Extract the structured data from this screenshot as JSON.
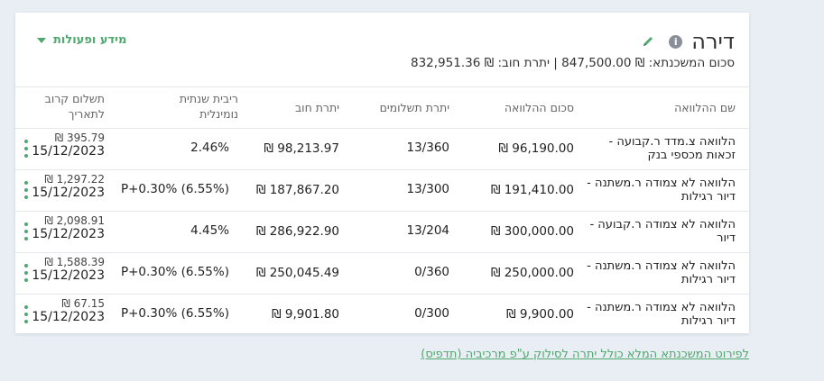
{
  "header": {
    "title": "דירה",
    "info_icon": "i",
    "subtitle": "סכום המשכנתא: ‎847,500.00 ₪‎ | יתרת חוב: ‎832,951.36 ₪‎",
    "actions_label": "מידע ופעולות"
  },
  "table": {
    "columns": {
      "name": "שם ההלוואה",
      "amount": "סכום ההלוואה",
      "payments": "יתרת תשלומים",
      "balance": "יתרת חוב",
      "rate": "ריבית שנתית נומינלית",
      "next": "תשלום קרוב לתאריך"
    },
    "rows": [
      {
        "name": "הלוואה צ.מדד ר.קבועה - זכאות מכספי בנק",
        "amount": "96,190.00 ₪",
        "payments": "13/360",
        "balance": "98,213.97 ₪",
        "rate": "2.46%",
        "next_amount": "395.79 ₪",
        "next_date": "15/12/2023"
      },
      {
        "name": "הלוואה לא צמודה ר.משתנה - דיור רגילות",
        "amount": "191,410.00 ₪",
        "payments": "13/300",
        "balance": "187,867.20 ₪",
        "rate": "P+0.30% (6.55%)",
        "next_amount": "1,297.22 ₪",
        "next_date": "15/12/2023"
      },
      {
        "name": "הלוואה לא צמודה ר.קבועה - דיור",
        "amount": "300,000.00 ₪",
        "payments": "13/204",
        "balance": "286,922.90 ₪",
        "rate": "4.45%",
        "next_amount": "2,098.91 ₪",
        "next_date": "15/12/2023"
      },
      {
        "name": "הלוואה לא צמודה ר.משתנה - דיור רגילות",
        "amount": "250,000.00 ₪",
        "payments": "0/360",
        "balance": "250,045.49 ₪",
        "rate": "P+0.30% (6.55%)",
        "next_amount": "1,588.39 ₪",
        "next_date": "15/12/2023"
      },
      {
        "name": "הלוואה לא צמודה ר.משתנה - דיור רגילות",
        "amount": "9,900.00 ₪",
        "payments": "0/300",
        "balance": "9,901.80 ₪",
        "rate": "P+0.30% (6.55%)",
        "next_amount": "67.15 ₪",
        "next_date": "15/12/2023"
      }
    ]
  },
  "footer": {
    "link_text": "לפירוט המשכנתא המלא כולל יתרה לסילוק ע\"פ מרכיביה (תדפיס)"
  },
  "colors": {
    "accent": "#4fa86e",
    "background": "#e9eef5"
  },
  "icons": {
    "edit": "pencil-icon",
    "info": "info-icon",
    "dropdown": "triangle-down-icon",
    "row_menu": "kebab-menu-icon"
  }
}
